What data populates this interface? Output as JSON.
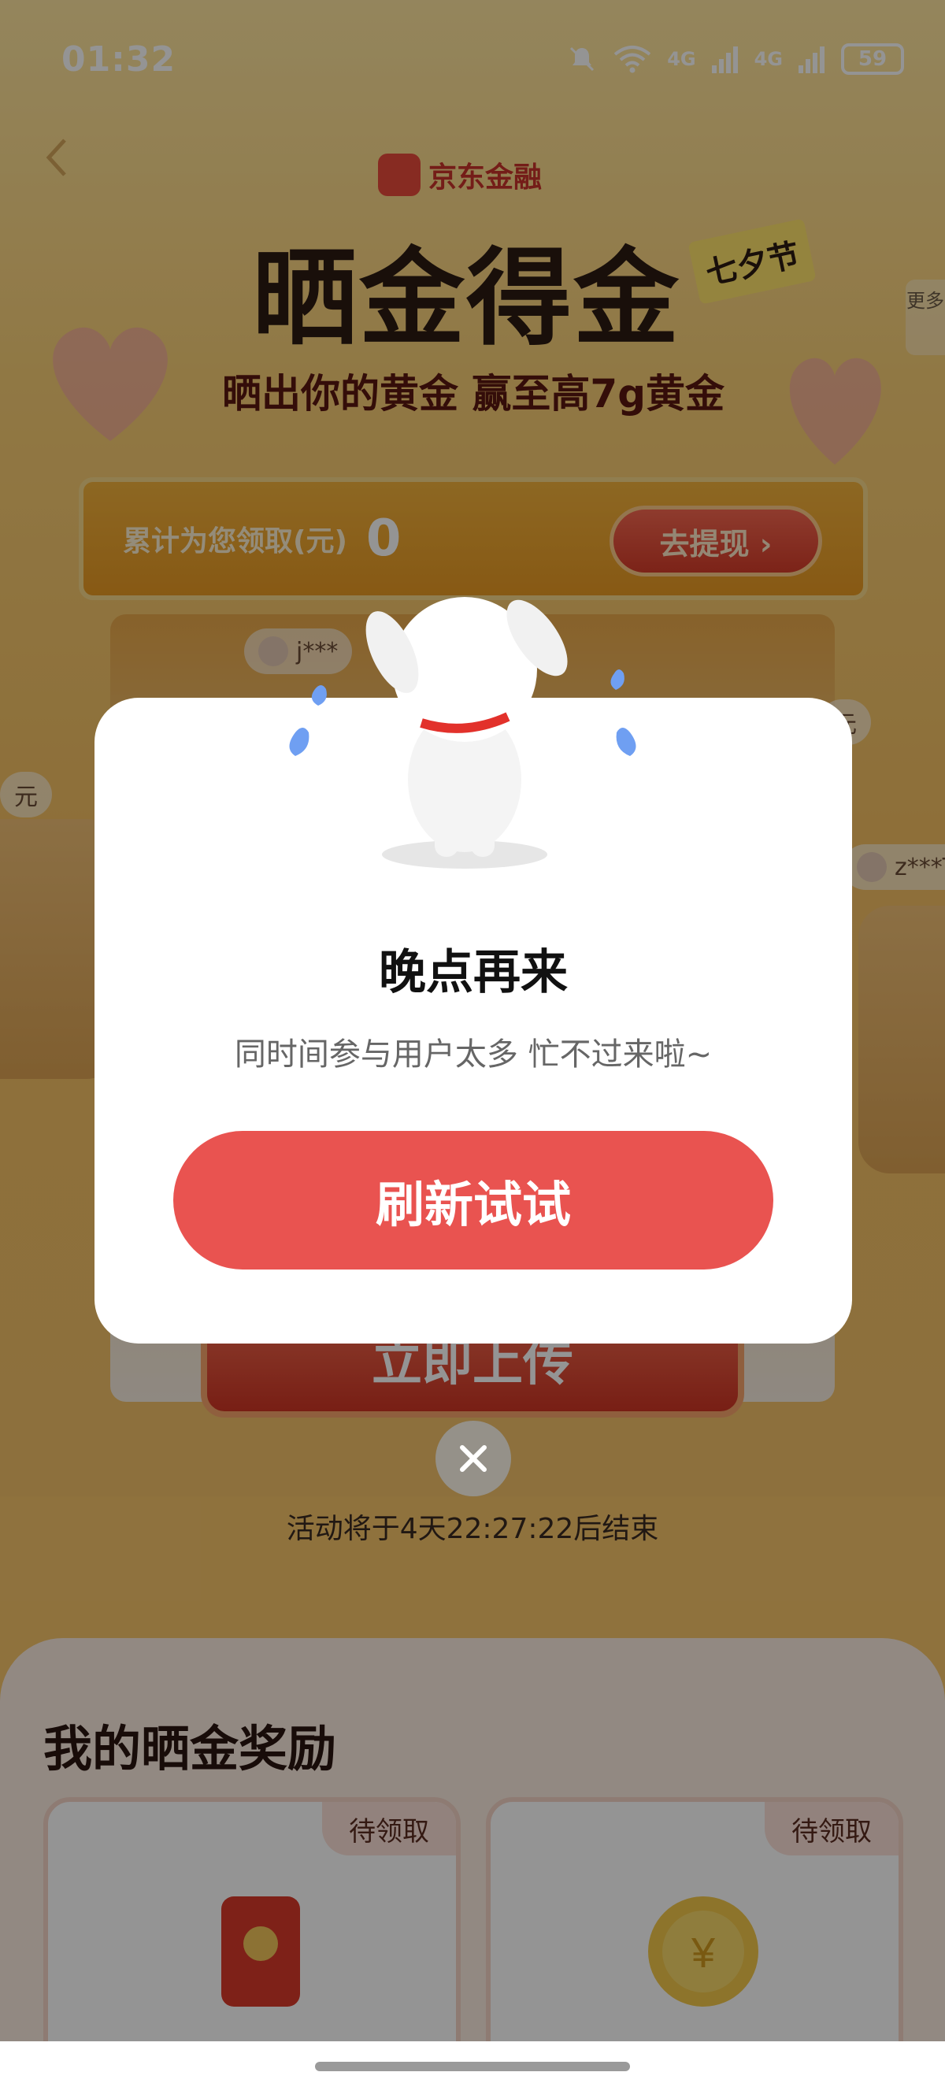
{
  "status_bar": {
    "time": "01:32",
    "network_1": "4G",
    "network_2": "4G",
    "battery": "59"
  },
  "header": {
    "brand": "京东金融",
    "title": "晒金得金",
    "tag": "七夕节",
    "subtitle": "晒出你的黄金 赢至高7g黄金",
    "more_tab": "更多"
  },
  "reward_summary": {
    "label": "累计为您领取(元)",
    "value": "0",
    "withdraw_label": "去提现 ›"
  },
  "tickers": [
    {
      "text": "j***"
    },
    {
      "text": "元"
    },
    {
      "text": "元"
    },
    {
      "text": "z***T"
    }
  ],
  "upload_button_label": "立即上传",
  "activity_timer": "活动将于4天22:27:22后结束",
  "my_rewards": {
    "title": "我的晒金奖励",
    "cards": [
      {
        "badge": "待领取",
        "icon": "red-envelope-icon"
      },
      {
        "badge": "待领取",
        "icon": "gold-coin-icon"
      }
    ]
  },
  "modal": {
    "title": "晚点再来",
    "message": "同时间参与用户太多 忙不过来啦~",
    "button_label": "刷新试试",
    "mascot_icon": "dog-mascot-icon",
    "close_icon": "close-icon"
  },
  "colors": {
    "primary_button": "#e95350",
    "brand_red": "#c9332a",
    "overlay": "rgba(0,0,0,0.42)"
  }
}
